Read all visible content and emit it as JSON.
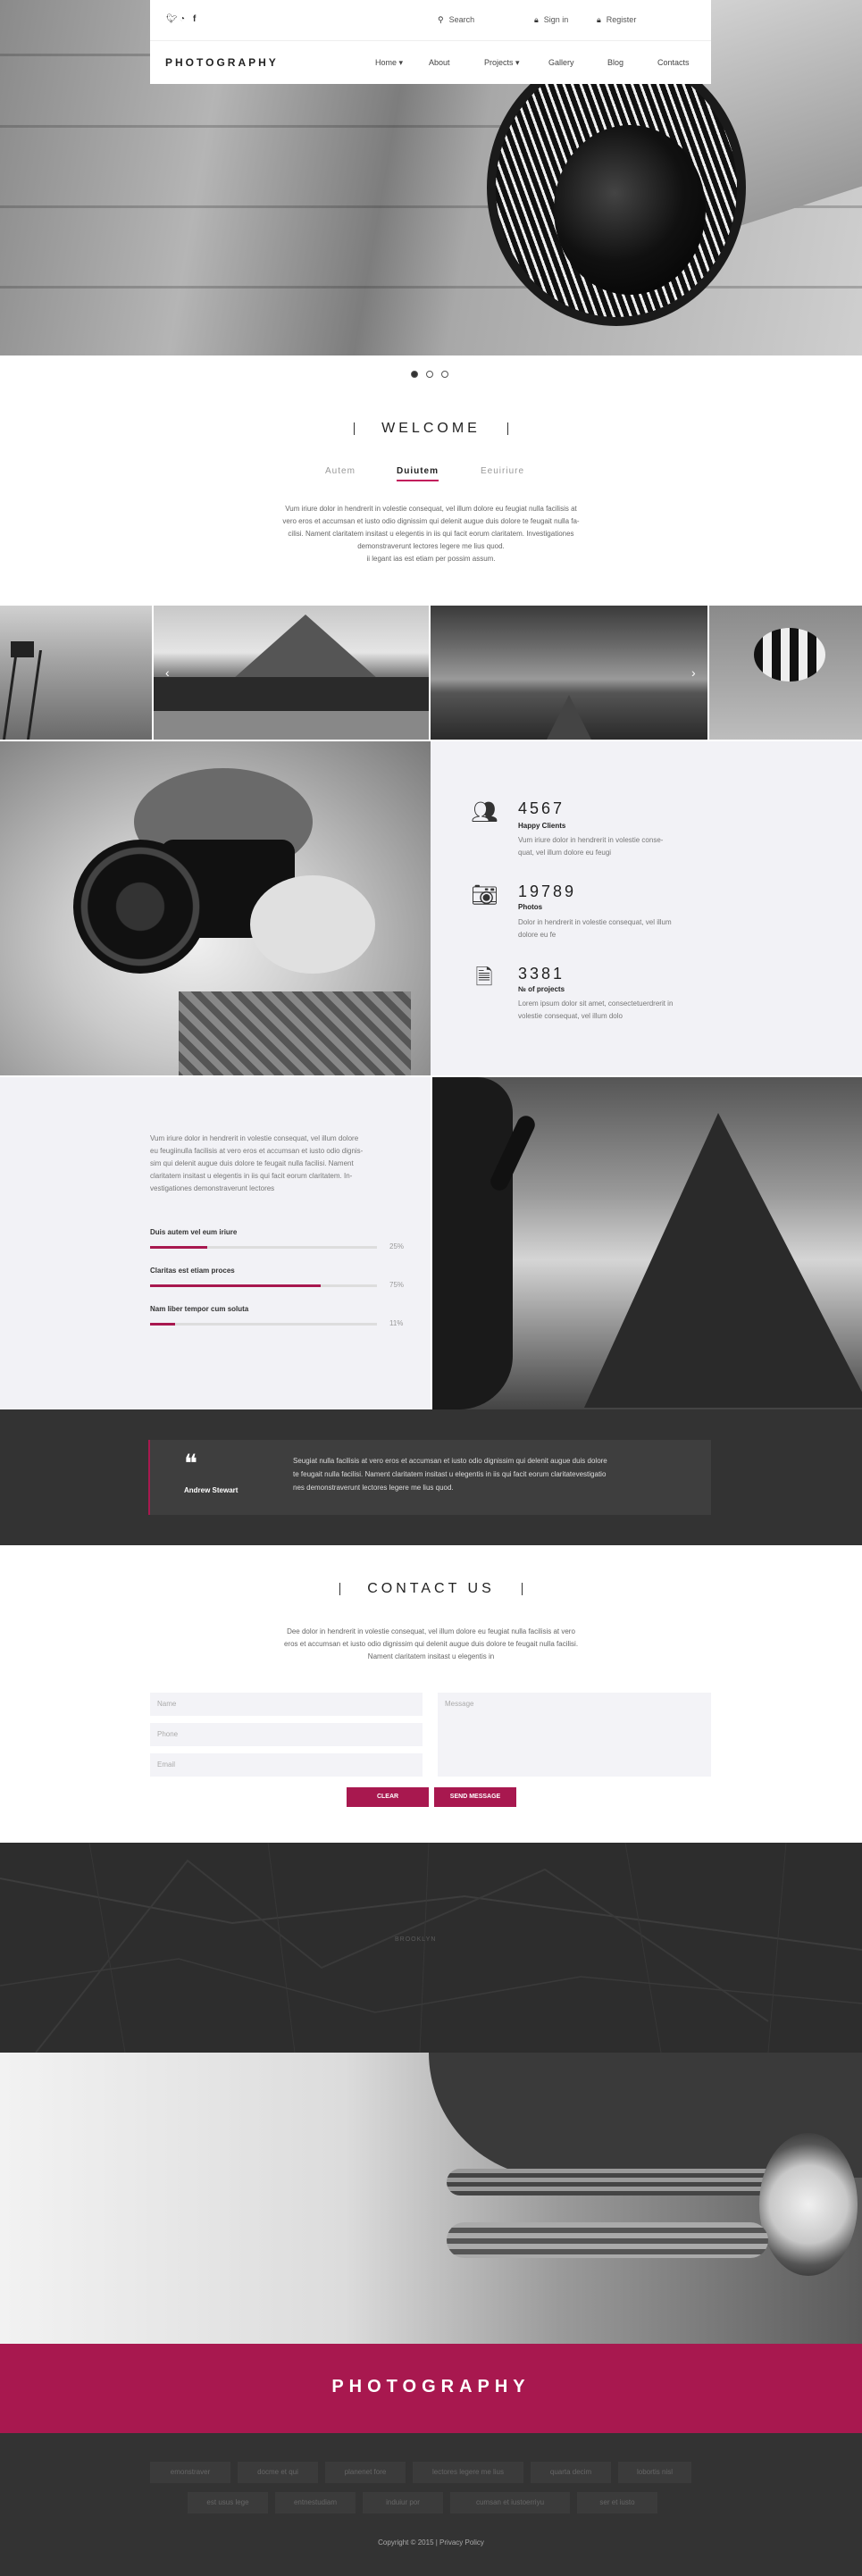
{
  "header": {
    "brand": "PHOTOGRAPHY",
    "search_label": "Search",
    "signin_label": "Sign in",
    "register_label": "Register",
    "social_icons": [
      "twitter-icon",
      "rss-icon",
      "facebook-icon"
    ],
    "nav": [
      "Home",
      "About",
      "Projects",
      "Gallery",
      "Blog",
      "Contacts"
    ]
  },
  "welcome": {
    "title": "WELCOME",
    "tabs": [
      "Autem",
      "Duiutem",
      "Eeuiriure"
    ],
    "active_tab": "Duiutem",
    "text_lines": [
      "Vum iriure dolor in hendrerit in volestie consequat, vel illum dolore eu feugiat nulla facilisis at",
      "vero eros et accumsan et iusto odio dignissim qui  delenit augue duis dolore te feugait nulla fa-",
      "cilisi. Nament claritatem insitast u elegentis in iis qui facit eorum claritatem. Investigationes",
      "demonstraverunt lectores legere me lius quod.",
      "ii legant ias est etiam per possim assum."
    ]
  },
  "stats": [
    {
      "icon": "users-icon",
      "number": "4567",
      "label": "Happy Clients",
      "text": [
        "Vum iriure dolor in hendrerit in volestie conse-",
        "quat, vel illum dolore eu feugi"
      ]
    },
    {
      "icon": "camera-icon",
      "number": "19789",
      "label": "Photos",
      "text": [
        "Dolor in hendrerit in volestie consequat, vel illum",
        "dolore eu fe"
      ]
    },
    {
      "icon": "document-icon",
      "number": "3381",
      "label": "№ of projects",
      "text": [
        "Lorem ipsum dolor sit amet, consectetuerdrerit in",
        "volestie consequat, vel illum dolo"
      ]
    }
  ],
  "skills": {
    "text_lines": [
      "Vum iriure dolor in hendrerit in volestie consequat, vel illum dolore",
      "eu feugiinulla facilisis at vero eros et accumsan et iusto odio dignis-",
      "sim qui  delenit augue duis dolore te feugait nulla facilisi. Nament",
      "claritatem insitast u elegentis in iis qui facit eorum claritatem.  In-",
      "vestigationes demonstraverunt lectores"
    ],
    "items": [
      {
        "label": "Duis autem vel eum iriure",
        "pct_label": "25%",
        "value": 0.25
      },
      {
        "label": "Claritas est etiam proces",
        "pct_label": "75%",
        "value": 0.75
      },
      {
        "label": "Nam liber tempor cum soluta",
        "pct_label": "11%",
        "value": 0.11
      }
    ]
  },
  "testimonial": {
    "author": "Andrew Stewart",
    "text_lines": [
      "Seugiat nulla facilisis at vero eros et accumsan et iusto odio dignissim qui  delenit augue duis dolore",
      "te feugait nulla facilisi. Nament claritatem insitast u elegentis in iis qui facit eorum claritatevestigatio",
      "nes demonstraverunt lectores legere me lius quod."
    ]
  },
  "contact": {
    "title": "CONTACT US",
    "text_lines": [
      "Dee dolor in hendrerit in volestie consequat, vel illum dolore eu feugiat nulla facilisis at vero",
      "eros et accumsan et iusto odio dignissim qui  delenit augue duis dolore te feugait nulla facilisi.",
      "Nament claritatem insitast u elegentis in"
    ],
    "name_placeholder": "Name",
    "phone_placeholder": "Phone",
    "email_placeholder": "Email",
    "message_placeholder": "Message",
    "clear_label": "CLEAR",
    "send_label": "SEND MESSAGE"
  },
  "map_labels": [
    "BROOKLYN"
  ],
  "brand_band": "PHOTOGRAPHY",
  "footer": {
    "tags_row1": [
      "emonstraver",
      "docme et qui",
      "planenet fore",
      "lectores legere me lius",
      "quarta decim",
      "lobortis nisl"
    ],
    "tags_row2": [
      "est usus lege",
      "entnestudiam",
      "induiur por",
      "cumsan et iustoerriyu",
      "ser et iusto"
    ],
    "copyright": "Copyright © 2015 | Privacy Policy"
  },
  "colors": {
    "accent": "#a8184f",
    "dark": "#333333",
    "panel": "#f2f2f6"
  }
}
